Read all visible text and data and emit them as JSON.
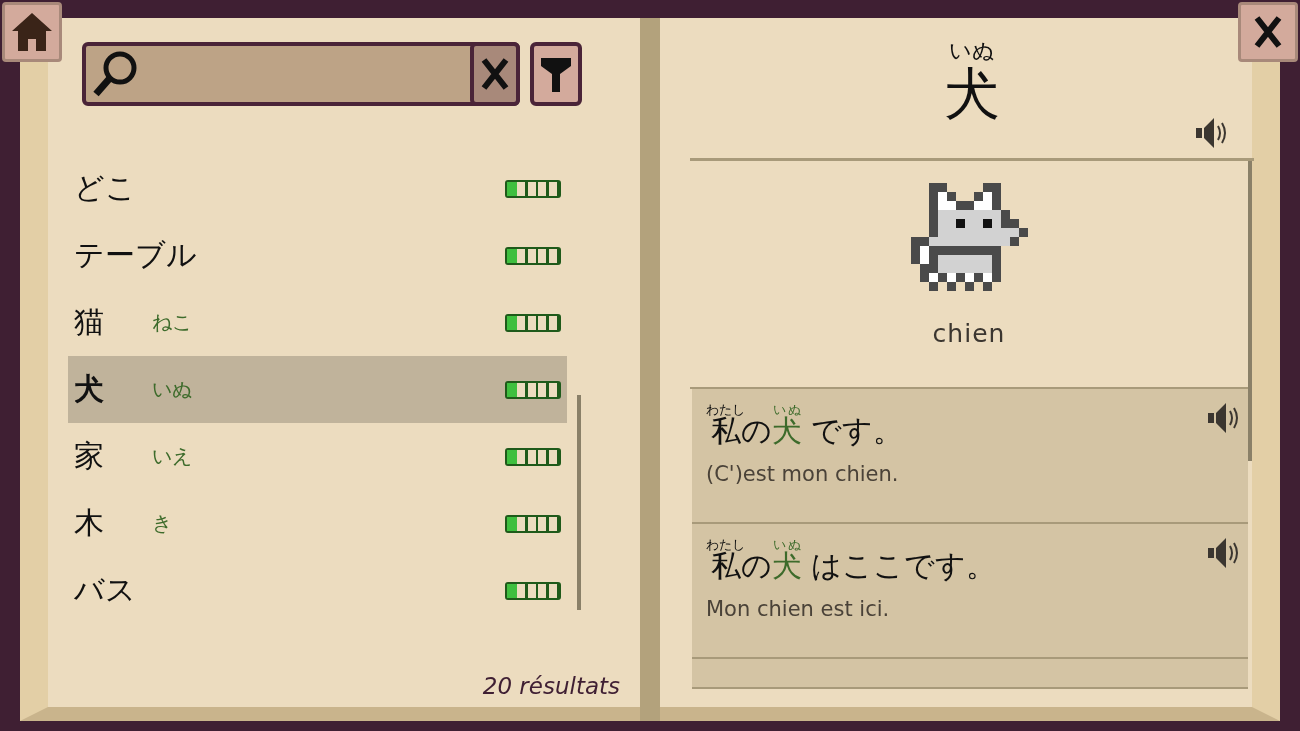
{
  "word_list": {
    "items": [
      {
        "word": "どこ",
        "selected": false,
        "level": 0.2
      },
      {
        "word": "テーブル",
        "selected": false,
        "level": 0.2
      },
      {
        "word": "猫",
        "reading": "ねこ",
        "selected": false,
        "level": 0.2
      },
      {
        "word": "犬",
        "reading": "いぬ",
        "selected": true,
        "level": 0.2
      },
      {
        "word": "家",
        "reading": "いえ",
        "selected": false,
        "level": 0.2
      },
      {
        "word": "木",
        "reading": "き",
        "selected": false,
        "level": 0.2
      },
      {
        "word": "バス",
        "selected": false,
        "level": 0.2
      }
    ],
    "results_count": "20 résultats"
  },
  "entry": {
    "reading": "いぬ",
    "word": "犬",
    "translation": "chien"
  },
  "examples": [
    {
      "segments": [
        {
          "text": "私",
          "ruby": "わたし",
          "kind": "plain"
        },
        {
          "text": "の",
          "kind": "plain"
        },
        {
          "text": "犬",
          "ruby": "いぬ",
          "kind": "target"
        },
        {
          "text": " です。",
          "kind": "plain"
        }
      ],
      "translation": "(C')est mon chien."
    },
    {
      "segments": [
        {
          "text": "私",
          "ruby": "わたし",
          "kind": "plain"
        },
        {
          "text": "の",
          "kind": "plain"
        },
        {
          "text": "犬",
          "ruby": "いぬ",
          "kind": "target"
        },
        {
          "text": " はここです。",
          "kind": "plain"
        }
      ],
      "translation": "Mon chien est ici."
    }
  ]
}
